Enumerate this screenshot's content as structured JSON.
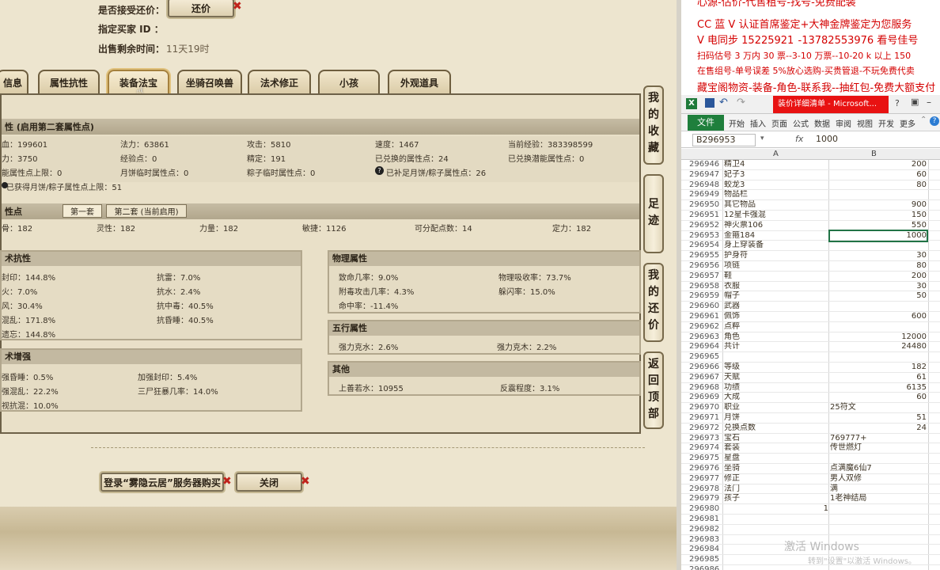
{
  "game": {
    "accept_counter_label": "是否接受还价：",
    "counter_button": "还价",
    "buyer_id_label": "指定买家 ID ：",
    "time_left_label": "出售剩余时间：",
    "time_left_value": "11天19时",
    "tabs": [
      "信息",
      "属性抗性",
      "装备法宝",
      "坐骑召唤兽",
      "法术修正",
      "小孩",
      "外观道具"
    ],
    "section1_title": "性 (启用第二套属性点)",
    "stats_row1": [
      "血：199601",
      "法力：63861",
      "攻击：5810",
      "速度：1467",
      "当前经验：383398599"
    ],
    "stats_row2": [
      "力：3750",
      "经验点：0",
      "精定：191",
      "已兑换的属性点：24",
      "已兑换潜能属性点：0"
    ],
    "stats_row3": [
      "能属性点上限：0",
      "月饼临时属性点：0",
      "粽子临时属性点：0",
      "已补足月饼/粽子属性点：26"
    ],
    "stats_row4": "已获得月饼/粽子属性点上限：51",
    "section2_title": "性点",
    "subtabs": [
      "第一套",
      "第二套 (当前启用)"
    ],
    "points_row": [
      "骨：182",
      "灵性：182",
      "力量：182",
      "敏捷：1126",
      "可分配点数：14",
      "定力：182"
    ],
    "resist": {
      "title": "术抗性",
      "left": [
        "封印：144.8%",
        "火：7.0%",
        "风：30.4%",
        "混乱：171.8%",
        "遗忘：144.8%"
      ],
      "right": [
        "抗雷：7.0%",
        "抗水：2.4%",
        "抗中毒：40.5%",
        "抗昏睡：40.5%"
      ]
    },
    "boost": {
      "title": "术增强",
      "left": [
        "强昏睡：0.5%",
        "强混乱：22.2%",
        "视抗混：10.0%"
      ],
      "right": [
        "加强封印：5.4%",
        "三尸狂暴几率：14.0%"
      ]
    },
    "physical": {
      "title": "物理属性",
      "left": [
        "致命几率：9.0%",
        "附毒攻击几率：4.3%",
        "命中率：-11.4%"
      ],
      "right": [
        "物理吸收率：73.7%",
        "躲闪率：15.0%"
      ]
    },
    "five": {
      "title": "五行属性",
      "left": "强力克水：2.6%",
      "right": "强力克木：2.2%"
    },
    "other": {
      "title": "其他",
      "left": "上善若水：10955",
      "right": "反震程度：3.1%"
    },
    "side_buttons": [
      "我的收藏",
      "足迹",
      "我的还价",
      "返回顶部"
    ],
    "login_button": "登录“雾隐云居”服务器购买",
    "close_button": "关闭"
  },
  "promo": {
    "line0": "心源-估价-代售租号-找号-免费配装",
    "line1": "CC 蓝 V 认证首席鉴定+大神金牌鉴定为您服务",
    "line2": "V 电同步 15225921  -13782553976 看号佳号",
    "line3": "扫码估号 3 万内 30 票--3-10 万票--10-20 k 以上 150",
    "line4": "在售组号-单号误差 5%放心选购-买贵管退-不玩免费代卖",
    "line5": "藏宝阁物资-装备-角色-联系我--抽红包-免费大额支付"
  },
  "excel": {
    "icon": "X",
    "title": "装价详细清单 - Microsoft...",
    "file_tab": "文件",
    "ribbon_tabs": [
      "开始",
      "插入",
      "页面",
      "公式",
      "数据",
      "审阅",
      "视图",
      "开发",
      "更多"
    ],
    "name_box": "B296953",
    "fx": "fx",
    "formula_value": "1000",
    "col_a": "A",
    "col_b": "B",
    "rows": [
      {
        "n": "296946",
        "a": "精卫4",
        "b": "200"
      },
      {
        "n": "296947",
        "a": "妃子3",
        "b": "60"
      },
      {
        "n": "296948",
        "a": "蛟龙3",
        "b": "80"
      },
      {
        "n": "296949",
        "a": "物品栏",
        "b": ""
      },
      {
        "n": "296950",
        "a": "其它物品",
        "b": "900"
      },
      {
        "n": "296951",
        "a": "12星卡强混",
        "b": "150"
      },
      {
        "n": "296952",
        "a": "神火票106",
        "b": "550"
      },
      {
        "n": "296953",
        "a": "金箍184",
        "b": "1000"
      },
      {
        "n": "296954",
        "a": "身上穿装备",
        "b": ""
      },
      {
        "n": "296955",
        "a": "护身符",
        "b": "30"
      },
      {
        "n": "296956",
        "a": "项链",
        "b": "80"
      },
      {
        "n": "296957",
        "a": "鞋",
        "b": "200"
      },
      {
        "n": "296958",
        "a": "衣服",
        "b": "30"
      },
      {
        "n": "296959",
        "a": "帽子",
        "b": "50"
      },
      {
        "n": "296960",
        "a": "武器",
        "b": ""
      },
      {
        "n": "296961",
        "a": "佩饰",
        "b": "600"
      },
      {
        "n": "296962",
        "a": "点粹",
        "b": ""
      },
      {
        "n": "296963",
        "a": "角色",
        "b": "12000"
      },
      {
        "n": "296964",
        "a": "共计",
        "b": "24480"
      },
      {
        "n": "296965",
        "a": "",
        "b": ""
      },
      {
        "n": "296966",
        "a": "等级",
        "b": "182"
      },
      {
        "n": "296967",
        "a": "天赋",
        "b": "61"
      },
      {
        "n": "296968",
        "a": "功绩",
        "b": "6135"
      },
      {
        "n": "296969",
        "a": "大成",
        "b": "60"
      },
      {
        "n": "296970",
        "a": "职业",
        "b": "25符文"
      },
      {
        "n": "296971",
        "a": "月饼",
        "b": "51"
      },
      {
        "n": "296972",
        "a": "兑换点数",
        "b": "24"
      },
      {
        "n": "296973",
        "a": "宝石",
        "b": "769777+"
      },
      {
        "n": "296974",
        "a": "套装",
        "b": "传世燃灯"
      },
      {
        "n": "296975",
        "a": "星盘",
        "b": ""
      },
      {
        "n": "296976",
        "a": "坐骑",
        "b": "点满魔6仙7"
      },
      {
        "n": "296977",
        "a": "修正",
        "b": "男人双修"
      },
      {
        "n": "296978",
        "a": "法门",
        "b": "满"
      },
      {
        "n": "296979",
        "a": "孩子",
        "b": "1老神结局"
      },
      {
        "n": "296980",
        "a": "1",
        "b": ""
      },
      {
        "n": "296981",
        "a": "",
        "b": ""
      },
      {
        "n": "296982",
        "a": "",
        "b": ""
      },
      {
        "n": "296983",
        "a": "",
        "b": ""
      },
      {
        "n": "296984",
        "a": "",
        "b": ""
      },
      {
        "n": "296985",
        "a": "",
        "b": ""
      },
      {
        "n": "296986",
        "a": "",
        "b": ""
      }
    ],
    "watermark": "激活 Windows",
    "watermark_sub": "转到\"设置\"以激活 Windows。"
  }
}
